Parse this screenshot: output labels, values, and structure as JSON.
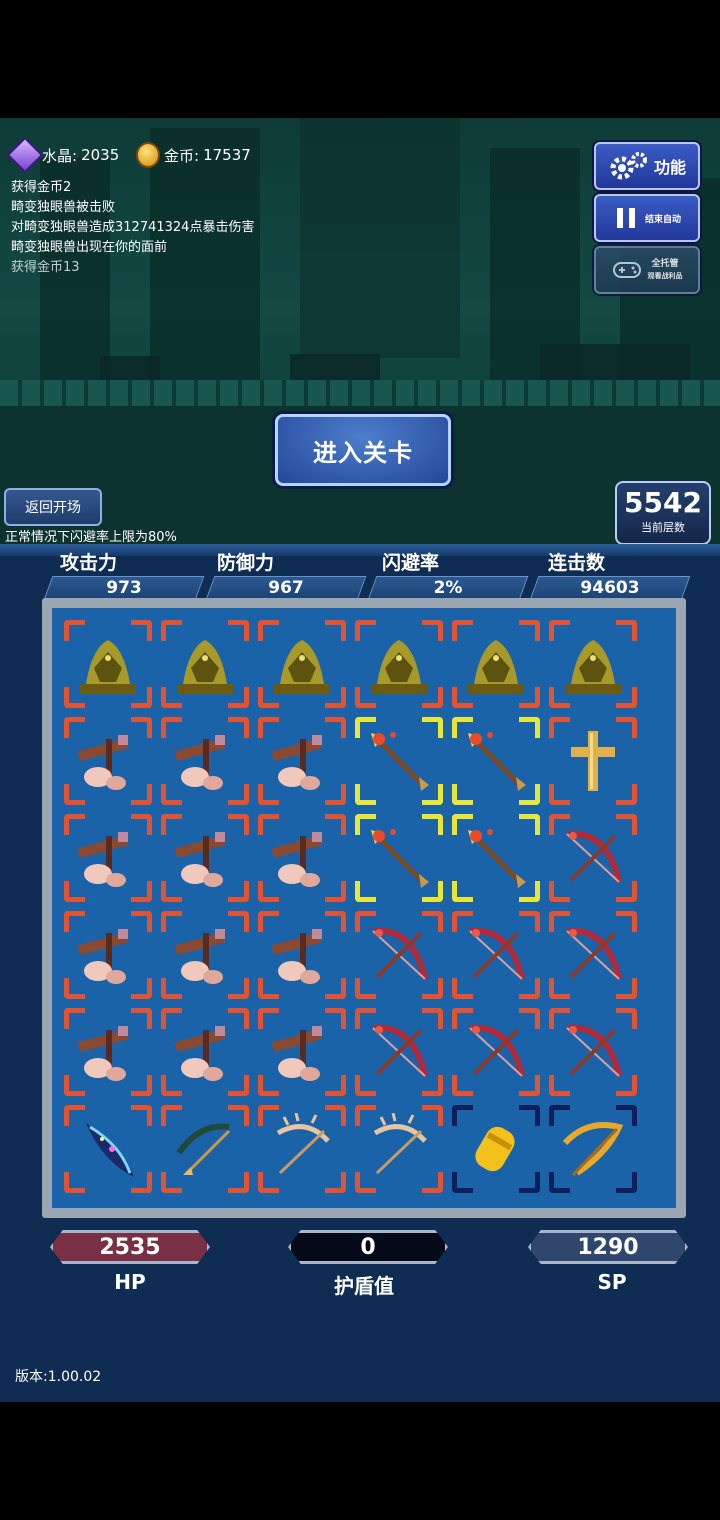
{
  "resources": {
    "crystal_label": "水晶:",
    "crystal_value": "2035",
    "gold_label": "金币:",
    "gold_value": "17537"
  },
  "log": [
    "获得金币2",
    "畸变独眼兽被击败",
    "对畸变独眼兽造成312741324点暴击伤害",
    "畸变独眼兽出现在你的面前",
    "获得金币13"
  ],
  "side_buttons": {
    "function": "功能",
    "stop_auto": "结束自动",
    "full_hosting": "全托管",
    "full_hosting_sub": "观看战利品"
  },
  "enter_stage": "进入关卡",
  "back_button": "返回开场",
  "dodge_note": "正常情况下闪避率上限为80%",
  "floor": {
    "value": "5542",
    "label": "当前层数"
  },
  "stats": [
    {
      "label": "攻击力",
      "value": "973"
    },
    {
      "label": "防御力",
      "value": "967"
    },
    {
      "label": "闪避率",
      "value": "2%"
    },
    {
      "label": "连击数",
      "value": "94603"
    }
  ],
  "grid": [
    [
      "dragon-statue",
      "dragon-statue",
      "dragon-statue",
      "dragon-statue",
      "dragon-statue",
      "dragon-statue"
    ],
    [
      "crossbow-hand",
      "crossbow-hand",
      "crossbow-hand",
      "fire-arrow",
      "fire-arrow",
      "golden-cross"
    ],
    [
      "crossbow-hand",
      "crossbow-hand",
      "crossbow-hand",
      "fire-arrow",
      "fire-arrow",
      "crimson-bow"
    ],
    [
      "crossbow-hand",
      "crossbow-hand",
      "crossbow-hand",
      "crimson-bow",
      "crimson-bow",
      "crimson-bow"
    ],
    [
      "crossbow-hand",
      "crossbow-hand",
      "crossbow-hand",
      "crimson-bow",
      "crimson-bow",
      "crimson-bow"
    ],
    [
      "rainbow-blade",
      "dark-bow",
      "antler-bow",
      "antler-bow",
      "gold-bracer",
      "golden-bow"
    ]
  ],
  "grid_frames": [
    [
      "red",
      "red",
      "red",
      "red",
      "red",
      "red"
    ],
    [
      "red",
      "red",
      "red",
      "gold",
      "gold",
      "red"
    ],
    [
      "red",
      "red",
      "red",
      "gold",
      "gold",
      "red"
    ],
    [
      "red",
      "red",
      "red",
      "red",
      "red",
      "red"
    ],
    [
      "red",
      "red",
      "red",
      "red",
      "red",
      "red"
    ],
    [
      "red",
      "red",
      "red",
      "red",
      "blue",
      "blue"
    ]
  ],
  "bottom": {
    "hp_value": "2535",
    "hp_label": "HP",
    "shield_value": "0",
    "shield_label": "护盾值",
    "sp_value": "1290",
    "sp_label": "SP"
  },
  "version": "版本:1.00.02"
}
